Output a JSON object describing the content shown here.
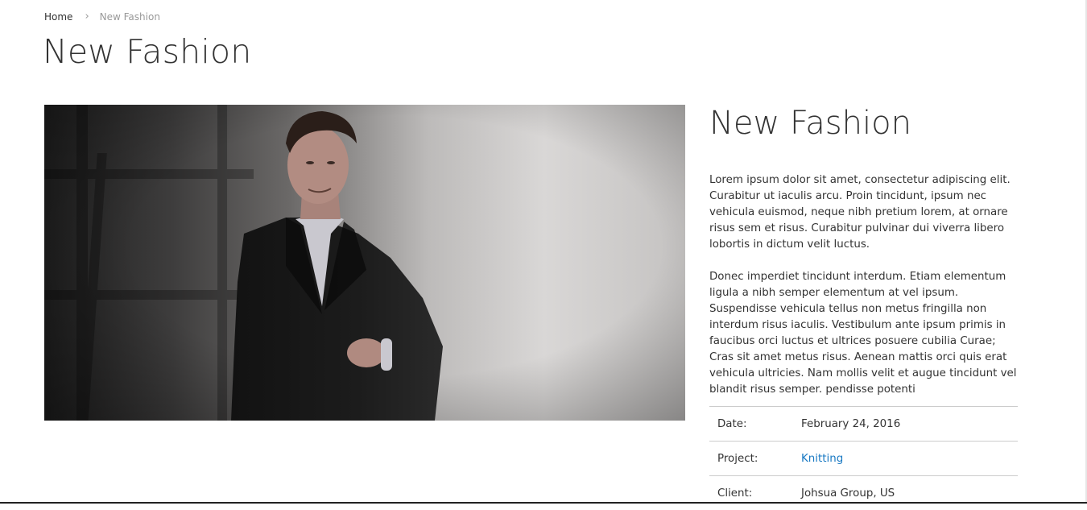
{
  "breadcrumb": {
    "home": "Home",
    "current": "New Fashion"
  },
  "page_title": "New Fashion",
  "detail": {
    "title": "New Fashion",
    "paragraph1": "Lorem ipsum dolor sit amet, consectetur adipiscing elit. Curabitur ut iaculis arcu. Proin tincidunt, ipsum nec vehicula euismod, neque nibh pretium lorem, at ornare risus sem et risus. Curabitur pulvinar dui viverra libero lobortis in dictum velit luctus.",
    "paragraph2": "Donec imperdiet tincidunt interdum. Etiam elementum ligula a nibh semper elementum at vel ipsum. Suspendisse vehicula tellus non metus fringilla non interdum risus iaculis. Vestibulum ante ipsum primis in faucibus orci luctus et ultrices posuere cubilia Curae; Cras sit amet metus risus. Aenean mattis orci quis erat vehicula ultricies. Nam mollis velit et augue tincidunt vel blandit risus semper. pendisse potenti"
  },
  "meta": {
    "date_label": "Date:",
    "date_value": "February 24, 2016",
    "project_label": "Project:",
    "project_value": "Knitting",
    "client_label": "Client:",
    "client_value": "Johsua Group, US"
  },
  "colors": {
    "link": "#1979c3",
    "text": "#333333",
    "muted": "#999999"
  },
  "icons": {
    "breadcrumb_separator": "chevron-right-icon"
  }
}
